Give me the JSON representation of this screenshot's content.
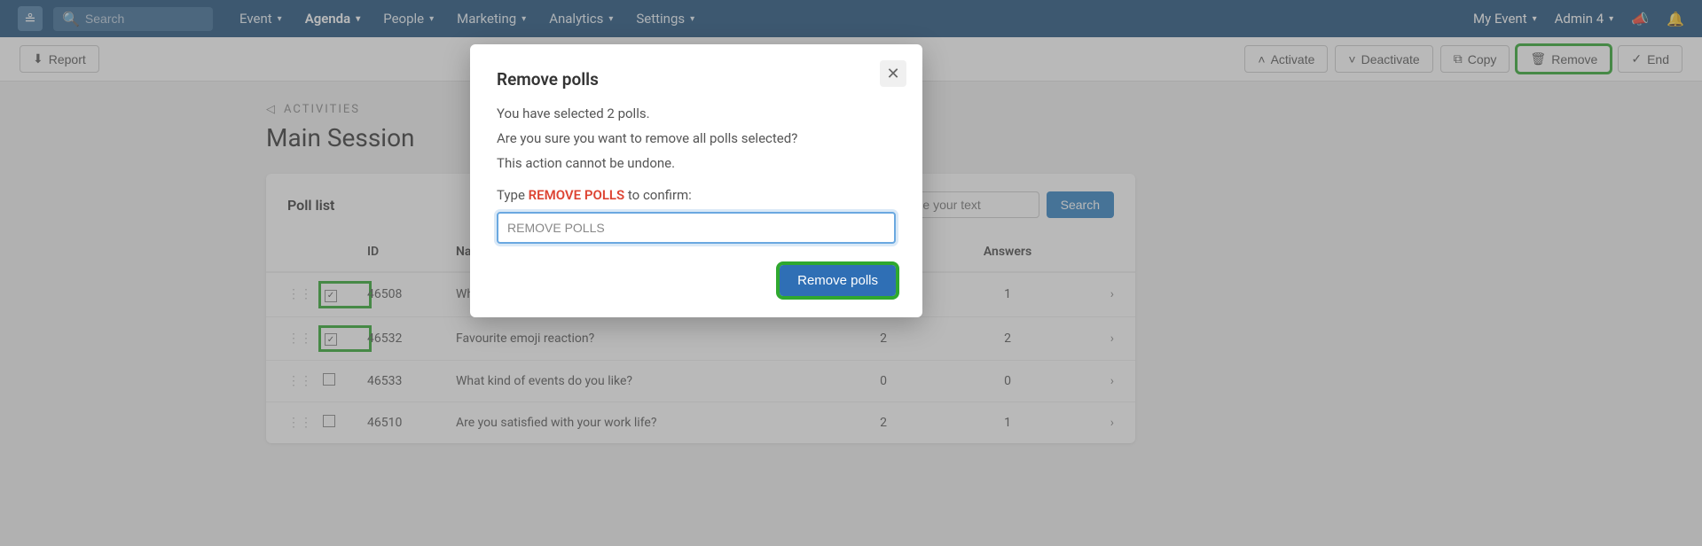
{
  "topbar": {
    "search_placeholder": "Search",
    "nav": [
      {
        "label": "Event",
        "active": false
      },
      {
        "label": "Agenda",
        "active": true
      },
      {
        "label": "People",
        "active": false
      },
      {
        "label": "Marketing",
        "active": false
      },
      {
        "label": "Analytics",
        "active": false
      },
      {
        "label": "Settings",
        "active": false
      }
    ],
    "event_selector": "My Event",
    "user": "Admin 4"
  },
  "toolbar": {
    "report": "Report",
    "activate": "Activate",
    "deactivate": "Deactivate",
    "copy": "Copy",
    "remove": "Remove",
    "end": "End"
  },
  "breadcrumb": {
    "back": "ACTIVITIES"
  },
  "page_title": "Main Session",
  "poll_list": {
    "title": "Poll list",
    "search_placeholder": "pe your text",
    "search_btn": "Search",
    "columns": {
      "id": "ID",
      "name": "Name",
      "votes": "",
      "answers": "Answers"
    },
    "rows": [
      {
        "id": "46508",
        "name": "Which typ",
        "votes": "",
        "answers": "1",
        "checked": true,
        "highlighted": true
      },
      {
        "id": "46532",
        "name": "Favourite emoji reaction?",
        "votes": "2",
        "answers": "2",
        "checked": true,
        "highlighted": true
      },
      {
        "id": "46533",
        "name": "What kind of events do you like?",
        "votes": "0",
        "answers": "0",
        "checked": false,
        "highlighted": false
      },
      {
        "id": "46510",
        "name": "Are you satisfied with your work life?",
        "votes": "2",
        "answers": "1",
        "checked": false,
        "highlighted": false
      }
    ]
  },
  "modal": {
    "title": "Remove polls",
    "line1": "You have selected 2 polls.",
    "line2": "Are you sure you want to remove all polls selected?",
    "line3": "This action cannot be undone.",
    "type_prefix": "Type ",
    "keyword": "REMOVE POLLS",
    "type_suffix": " to confirm:",
    "input_value": "REMOVE POLLS",
    "confirm_btn": "Remove polls"
  }
}
